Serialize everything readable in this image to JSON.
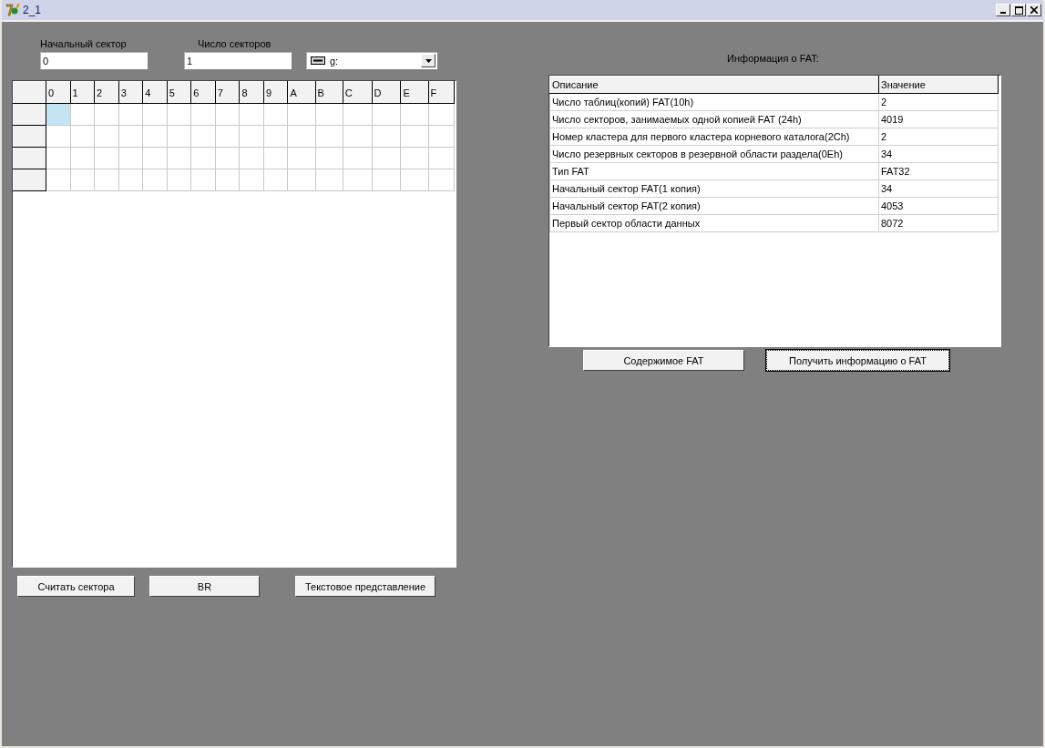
{
  "window": {
    "title": "2_1"
  },
  "start_sector": {
    "label": "Начальный сектор",
    "value": "0"
  },
  "sector_count": {
    "label": "Число секторов",
    "value": "1"
  },
  "drive": {
    "value": "g:"
  },
  "hex_grid": {
    "columns": [
      "0",
      "1",
      "2",
      "3",
      "4",
      "5",
      "6",
      "7",
      "8",
      "9",
      "A",
      "B",
      "C",
      "D",
      "E",
      "F"
    ],
    "rows": [
      {
        "cells": [
          {
            "selected": true
          },
          {
            "selected": false
          },
          {
            "selected": false
          },
          {
            "selected": false
          },
          {
            "selected": false
          },
          {
            "selected": false
          },
          {
            "selected": false
          },
          {
            "selected": false
          },
          {
            "selected": false
          },
          {
            "selected": false
          },
          {
            "selected": false
          },
          {
            "selected": false
          },
          {
            "selected": false
          },
          {
            "selected": false
          },
          {
            "selected": false
          },
          {
            "selected": false
          }
        ]
      },
      {
        "cells": [
          {
            "selected": false
          },
          {
            "selected": false
          },
          {
            "selected": false
          },
          {
            "selected": false
          },
          {
            "selected": false
          },
          {
            "selected": false
          },
          {
            "selected": false
          },
          {
            "selected": false
          },
          {
            "selected": false
          },
          {
            "selected": false
          },
          {
            "selected": false
          },
          {
            "selected": false
          },
          {
            "selected": false
          },
          {
            "selected": false
          },
          {
            "selected": false
          },
          {
            "selected": false
          }
        ]
      },
      {
        "cells": [
          {
            "selected": false
          },
          {
            "selected": false
          },
          {
            "selected": false
          },
          {
            "selected": false
          },
          {
            "selected": false
          },
          {
            "selected": false
          },
          {
            "selected": false
          },
          {
            "selected": false
          },
          {
            "selected": false
          },
          {
            "selected": false
          },
          {
            "selected": false
          },
          {
            "selected": false
          },
          {
            "selected": false
          },
          {
            "selected": false
          },
          {
            "selected": false
          },
          {
            "selected": false
          }
        ]
      },
      {
        "cells": [
          {
            "selected": false
          },
          {
            "selected": false
          },
          {
            "selected": false
          },
          {
            "selected": false
          },
          {
            "selected": false
          },
          {
            "selected": false
          },
          {
            "selected": false
          },
          {
            "selected": false
          },
          {
            "selected": false
          },
          {
            "selected": false
          },
          {
            "selected": false
          },
          {
            "selected": false
          },
          {
            "selected": false
          },
          {
            "selected": false
          },
          {
            "selected": false
          },
          {
            "selected": false
          }
        ]
      }
    ]
  },
  "left_buttons": [
    {
      "label": "Считать сектора",
      "focused": false
    },
    {
      "label": "BR",
      "focused": false
    },
    {
      "label": "Текстовое представление",
      "focused": false
    }
  ],
  "fat_info": {
    "title": "Информация о FAT:",
    "columns": [
      "Описание",
      "Значение"
    ],
    "rows": [
      [
        "Число таблиц(копий) FAT(10h)",
        "2"
      ],
      [
        "Число секторов, занимаемых одной копией FAT (24h)",
        "4019"
      ],
      [
        "Номер кластера для первого кластера корневого каталога(2Ch)",
        "2"
      ],
      [
        "Число резервных секторов в резервной области раздела(0Eh)",
        "34"
      ],
      [
        "Тип FAT",
        "FAT32"
      ],
      [
        "Начальный сектор FAT(1 копия)",
        "34"
      ],
      [
        "Начальный сектор FAT(2 копия)",
        "4053"
      ],
      [
        "Первый сектор области данных",
        "8072"
      ]
    ]
  },
  "right_buttons": [
    {
      "label": "Содержимое FAT",
      "focused": false
    },
    {
      "label": "Получить информацию о FAT",
      "focused": true
    }
  ]
}
